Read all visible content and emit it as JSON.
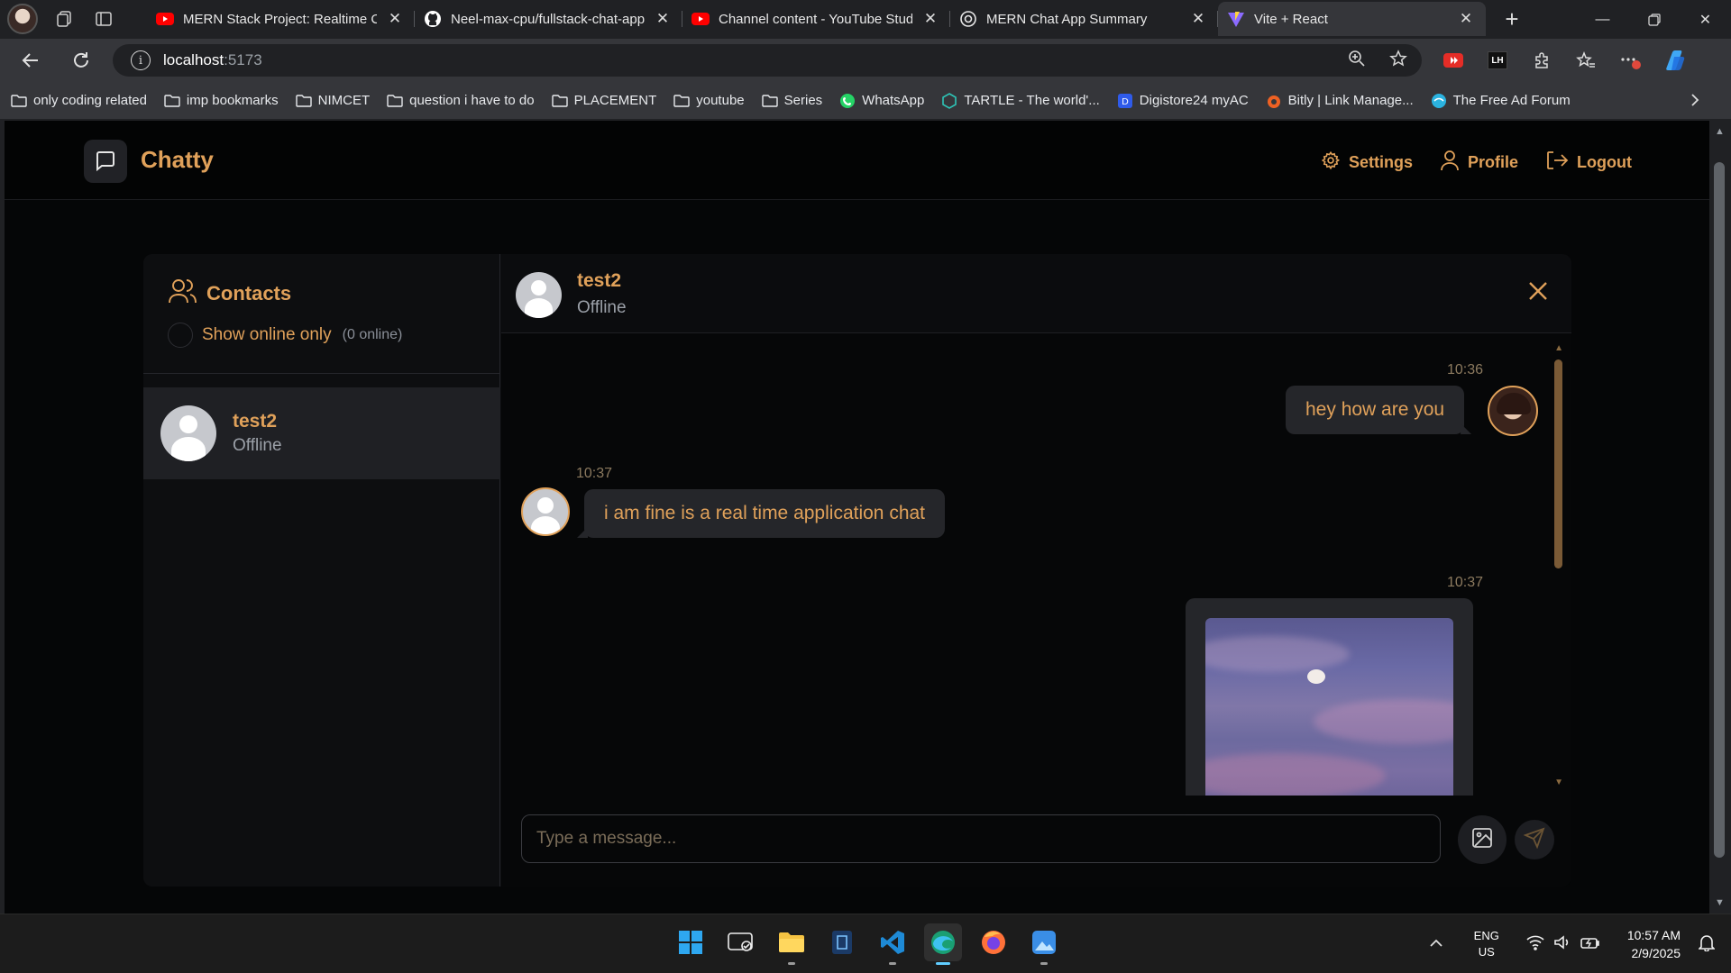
{
  "browser": {
    "tabs": [
      {
        "title": "MERN Stack Project: Realtime Chat",
        "favicon": "youtube-icon",
        "active": false
      },
      {
        "title": "Neel-max-cpu/fullstack-chat-app",
        "favicon": "github-icon",
        "active": false
      },
      {
        "title": "Channel content - YouTube Studio",
        "favicon": "youtube-studio-icon",
        "active": false
      },
      {
        "title": "MERN Chat App Summary",
        "favicon": "chatgpt-icon",
        "active": false
      },
      {
        "title": "Vite + React",
        "favicon": "vite-icon",
        "active": true
      }
    ],
    "url_host": "localhost",
    "url_port": ":5173",
    "bookmarks": [
      {
        "label": "only coding  related",
        "icon": "folder-icon"
      },
      {
        "label": "imp bookmarks",
        "icon": "folder-icon"
      },
      {
        "label": "NIMCET",
        "icon": "folder-icon"
      },
      {
        "label": "question i have to do",
        "icon": "folder-icon"
      },
      {
        "label": "PLACEMENT",
        "icon": "folder-icon"
      },
      {
        "label": "youtube",
        "icon": "folder-icon"
      },
      {
        "label": "Series",
        "icon": "folder-icon"
      },
      {
        "label": "WhatsApp",
        "icon": "whatsapp-icon"
      },
      {
        "label": "TARTLE - The world'...",
        "icon": "tartle-icon"
      },
      {
        "label": "Digistore24 myAC",
        "icon": "digistore-icon"
      },
      {
        "label": "Bitly | Link Manage...",
        "icon": "bitly-icon"
      },
      {
        "label": "The Free Ad Forum",
        "icon": "ad-forum-icon"
      }
    ],
    "extension_badge": "LH"
  },
  "app": {
    "brand": "Chatty",
    "nav": {
      "settings": "Settings",
      "profile": "Profile",
      "logout": "Logout"
    },
    "accent_color": "#e0a15a",
    "sidebar": {
      "title": "Contacts",
      "filter_label": "Show online only",
      "online_count": "(0 online)",
      "contacts": [
        {
          "name": "test2",
          "status": "Offline",
          "selected": true
        }
      ]
    },
    "chat": {
      "contact_name": "test2",
      "contact_status": "Offline",
      "messages": [
        {
          "time": "10:36",
          "text": "hey how are you",
          "side": "right"
        },
        {
          "time": "10:37",
          "text": "i am fine is a real time application chat",
          "side": "left"
        },
        {
          "time": "10:37",
          "text": "",
          "side": "right",
          "type": "image"
        }
      ],
      "input_placeholder": "Type a message..."
    }
  },
  "taskbar": {
    "apps": [
      "windows-start-icon",
      "widgets-icon",
      "file-explorer-icon",
      "terminal-icon",
      "vscode-icon",
      "edge-icon",
      "firefox-icon",
      "photos-icon"
    ],
    "lang_line1": "ENG",
    "lang_line2": "US",
    "time": "10:57 AM",
    "date": "2/9/2025"
  }
}
